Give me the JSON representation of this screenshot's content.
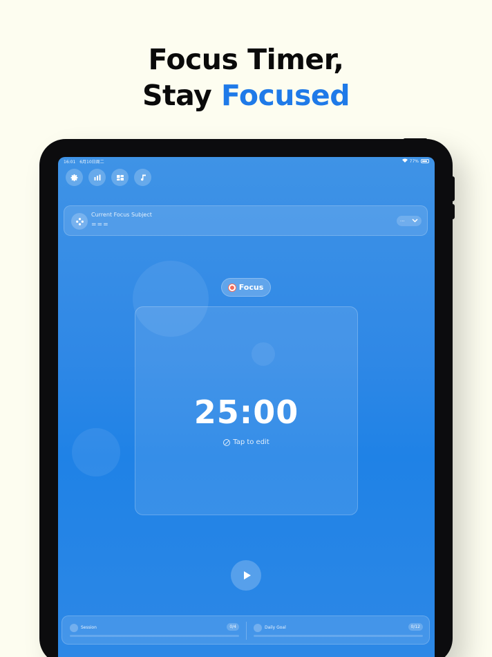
{
  "headline": {
    "line1": "Focus Timer,",
    "line2_plain": "Stay ",
    "line2_accent": "Focused"
  },
  "status_bar": {
    "time": "16:01",
    "date": "6月10日周二",
    "battery": "77%"
  },
  "toolbar": {
    "buttons": [
      {
        "icon": "gear-icon"
      },
      {
        "icon": "bar-chart-icon"
      },
      {
        "icon": "layout-icon"
      },
      {
        "icon": "music-note-icon"
      }
    ]
  },
  "subject": {
    "label": "Current Focus Subject",
    "value": "==="
  },
  "mode": {
    "label": "Focus",
    "icon": "target-icon"
  },
  "timer": {
    "value": "25:00",
    "hint": "Tap to edit"
  },
  "stats": {
    "session": {
      "label": "Session",
      "count": "0/4",
      "progress": 0
    },
    "daily_goal": {
      "label": "Daily Goal",
      "count": "0/12",
      "progress": 0
    }
  },
  "colors": {
    "accent": "#1f7ae8",
    "background": "#fdfdf0",
    "screen": "#2f88e6"
  }
}
